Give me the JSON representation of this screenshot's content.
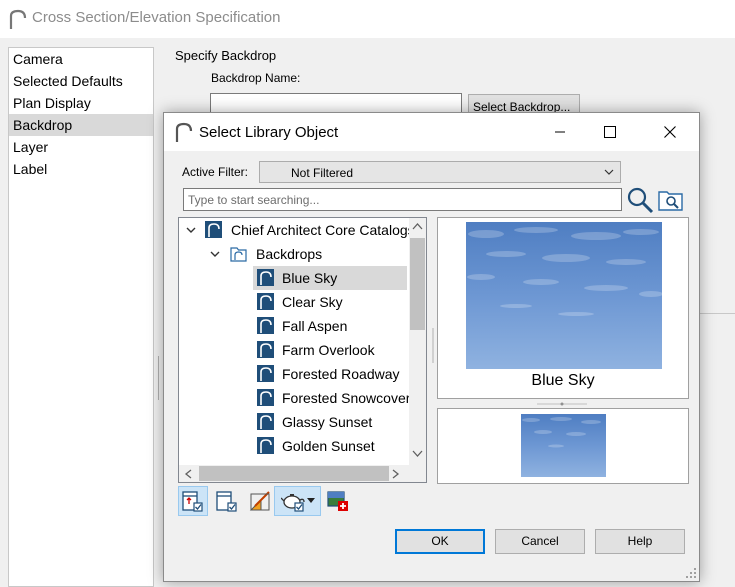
{
  "main_window": {
    "title": "Cross Section/Elevation Specification",
    "nav_items": [
      "Camera",
      "Selected Defaults",
      "Plan Display",
      "Backdrop",
      "Layer",
      "Label"
    ],
    "selected_nav": "Backdrop",
    "group_label": "Specify Backdrop",
    "backdrop_name_label": "Backdrop Name:",
    "backdrop_name_value": "",
    "select_backdrop_label": "Select Backdrop..."
  },
  "dialog": {
    "title": "Select Library Object",
    "active_filter_label": "Active Filter:",
    "active_filter_value": "Not Filtered",
    "search_placeholder": "Type to start searching...",
    "tree": {
      "catalog": "Chief Architect Core Catalogs",
      "folder": "Backdrops",
      "items": [
        "Blue Sky",
        "Clear Sky",
        "Fall Aspen",
        "Farm Overlook",
        "Forested Roadway",
        "Forested Snowcovered",
        "Glassy Sunset",
        "Golden Sunset"
      ],
      "selected": "Blue Sky"
    },
    "preview_label": "Blue Sky",
    "buttons": {
      "ok": "OK",
      "cancel": "Cancel",
      "help": "Help"
    }
  },
  "icons": {
    "logo": "chief-architect-logo-icon",
    "minimize": "minimize-icon",
    "maximize": "maximize-icon",
    "close": "close-icon",
    "search": "magnifier-icon",
    "folder_search": "folder-search-icon"
  },
  "colors": {
    "accent": "#0078d7",
    "item_icon": "#1f4e79",
    "selection": "#d9d9d9",
    "sky": "#6d97d3"
  }
}
